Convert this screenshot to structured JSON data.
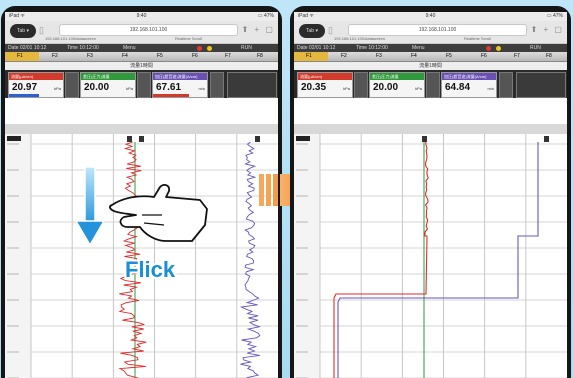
{
  "ipad": {
    "carrier": "iPad ᯤ",
    "time": "9:40",
    "battery": "▭ 47%"
  },
  "browser": {
    "tab_button": "Tab ▾",
    "url": "192.168.101.100",
    "tabs": [
      "192.168.101.100/datascreen",
      "Realtime Scroll"
    ]
  },
  "app_menu": {
    "items": [
      "Date 02/01 10:12",
      "Time 10:12:00",
      "Menu",
      "RUN"
    ],
    "status_colors": [
      "#e03a2f",
      "#f0c419"
    ]
  },
  "function_keys": [
    "F1",
    "F2",
    "F3",
    "F4",
    "F5",
    "F6",
    "F7",
    "F8"
  ],
  "panel_title": "流量1時間",
  "screens": [
    {
      "channels": [
        {
          "name": "流量(μA/cm)",
          "value": "20.97",
          "unit": "kPa",
          "color": "#d23a2c"
        },
        {
          "name": "差圧(圧力)流量",
          "value": "20.00",
          "unit": "kPa",
          "color": "#2f9a3a"
        },
        {
          "name": "加圧(超音波)流量(A/cm)",
          "value": "67.61",
          "unit": "m/s",
          "color": "#6a4fb5"
        }
      ]
    },
    {
      "channels": [
        {
          "name": "流量(μA/cm)",
          "value": "20.35",
          "unit": "kPa",
          "color": "#d23a2c"
        },
        {
          "name": "差圧(圧力)流量",
          "value": "20.00",
          "unit": "kPa",
          "color": "#2f9a3a"
        },
        {
          "name": "加圧(超音波)流量(A/cm)",
          "value": "64.84",
          "unit": "m/s",
          "color": "#6a4fb5"
        }
      ]
    }
  ],
  "gesture_label": "Flick",
  "colors": {
    "accent": "#1a8fd6",
    "arrow": "#f08a24",
    "trace_red": "#e02b2b",
    "trace_green": "#2f9a3a",
    "trace_purple": "#6a55c2"
  }
}
